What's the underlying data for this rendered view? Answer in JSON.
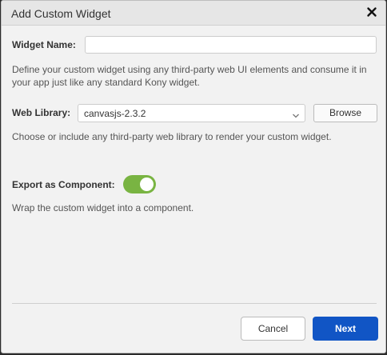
{
  "dialog": {
    "title": "Add Custom Widget",
    "close_icon": "close-icon"
  },
  "widget_name": {
    "label": "Widget Name:",
    "value": "",
    "placeholder": "",
    "description": "Define your custom widget using any third-party web UI elements and consume it in your app just like any standard Kony widget."
  },
  "web_library": {
    "label": "Web Library:",
    "selected": "canvasjs-2.3.2",
    "chevron_icon": "chevron-down-icon",
    "browse_label": "Browse",
    "description": "Choose or include any third-party web library to render your custom widget."
  },
  "export_component": {
    "label": "Export as Component:",
    "enabled": true,
    "description": "Wrap the custom widget into a component."
  },
  "footer": {
    "cancel_label": "Cancel",
    "next_label": "Next"
  },
  "colors": {
    "accent": "#1155c5",
    "toggle_on": "#79b442"
  }
}
